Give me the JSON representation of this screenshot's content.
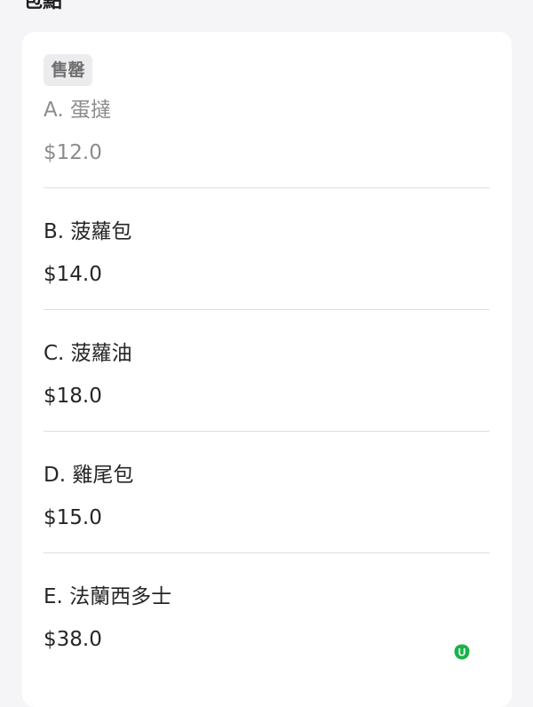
{
  "section": {
    "title": "包點"
  },
  "items": [
    {
      "label": "A. 蛋撻",
      "price": "$12.0",
      "badge": "售罄",
      "sold_out": true
    },
    {
      "label": "B. 菠蘿包",
      "price": "$14.0",
      "sold_out": false
    },
    {
      "label": "C. 菠蘿油",
      "price": "$18.0",
      "sold_out": false
    },
    {
      "label": "D. 雞尾包",
      "price": "$15.0",
      "sold_out": false
    },
    {
      "label": "E. 法蘭西多士",
      "price": "$38.0",
      "sold_out": false
    }
  ],
  "watermark": {
    "icon": "u-logo-icon",
    "letter": "U",
    "color": "#1bb34a"
  }
}
